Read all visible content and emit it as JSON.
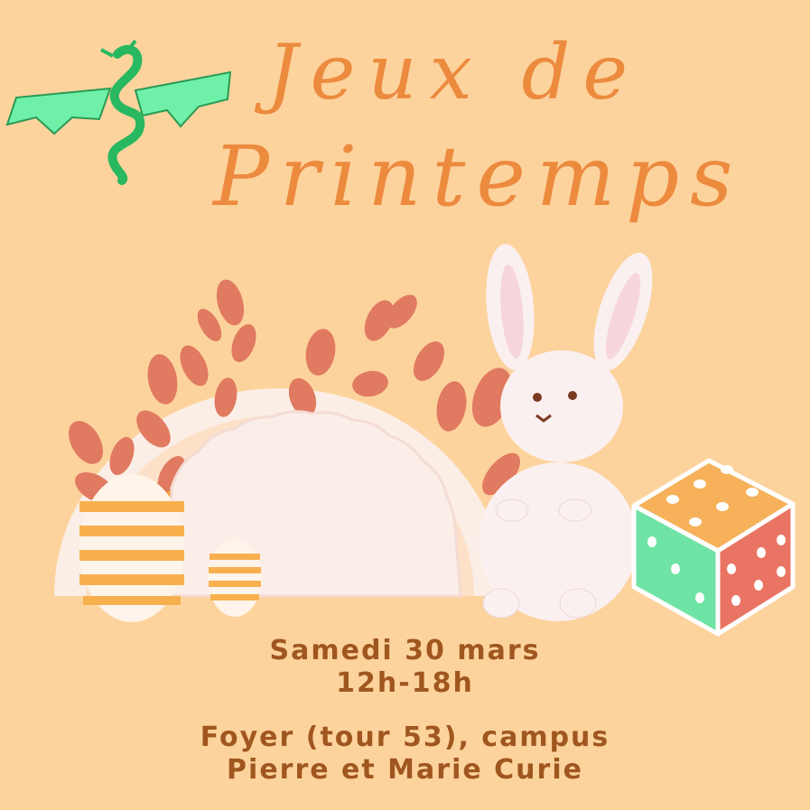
{
  "poster": {
    "title_line_1": "Jeux de",
    "title_line_2": "Printemps",
    "date": "Samedi 30 mars",
    "time": "12h-18h",
    "location_line_1": "Foyer (tour 53), campus",
    "location_line_2": "Pierre et Marie Curie"
  },
  "colors": {
    "background": "#fdd39d",
    "title": "#ec8a3e",
    "info_text": "#a0561f",
    "dragon": "#3ad07a",
    "rainbow_orange": "#f7a23a",
    "leaves": "#e07a60",
    "dice_top": "#f6b15a",
    "dice_left": "#6fe3a5",
    "dice_right": "#ea7463"
  },
  "icons": [
    "dragon-icon",
    "rainbow-illustration",
    "bunny-figurine",
    "easter-egg",
    "dice-icon"
  ]
}
